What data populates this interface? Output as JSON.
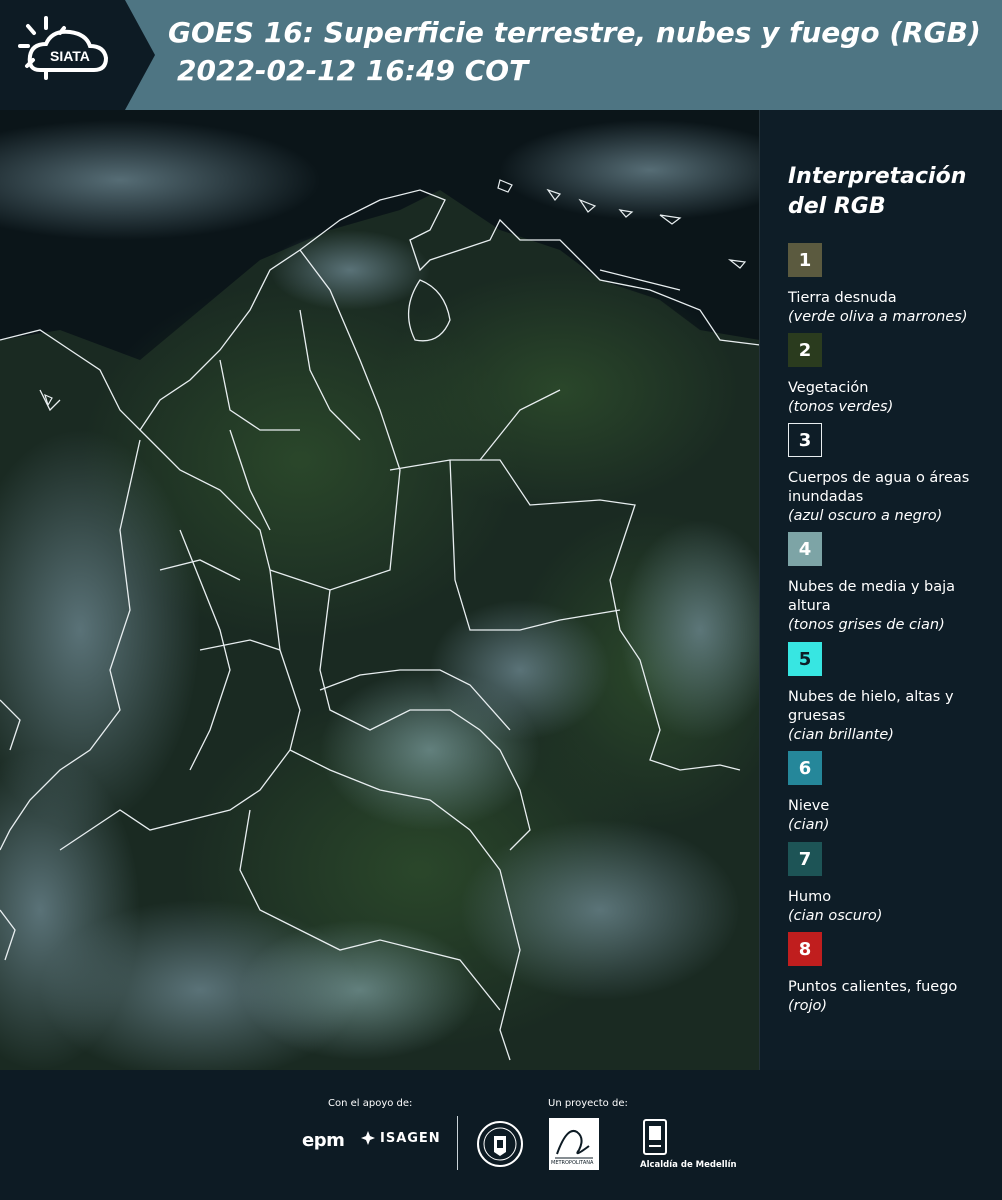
{
  "header": {
    "logo_text": "SIATA",
    "title_line1": "GOES 16: Superficie terrestre, nubes y fuego (RGB)",
    "title_line2": "2022-02-12 16:49 COT",
    "bar_color": "#4e7583",
    "logo_bg_color": "#0d1b24"
  },
  "map": {
    "description_icon": "satellite-map"
  },
  "legend": {
    "title_line1": "Interpretación",
    "title_line2": "del RGB",
    "items": [
      {
        "number": "1",
        "label": "Tierra desnuda",
        "desc": "(verde oliva a marrones)",
        "color": "#5b5a3f"
      },
      {
        "number": "2",
        "label": "Vegetación",
        "desc": "(tonos verdes)",
        "color": "#2a3b1e"
      },
      {
        "number": "3",
        "label": "Cuerpos de agua o áreas inundadas",
        "desc": "(azul oscuro a negro)",
        "color": "#0e1d27"
      },
      {
        "number": "4",
        "label": "Nubes de media y baja altura",
        "desc": "(tonos grises de cian)",
        "color": "#7da4a6"
      },
      {
        "number": "5",
        "label": "Nubes de hielo, altas y gruesas",
        "desc": "(cian brillante)",
        "color": "#37e6e2"
      },
      {
        "number": "6",
        "label": "Nieve",
        "desc": "(cian)",
        "color": "#25879a"
      },
      {
        "number": "7",
        "label": "Humo",
        "desc": "(cian oscuro)",
        "color": "#1d5456"
      },
      {
        "number": "8",
        "label": "Puntos calientes, fuego",
        "desc": "(rojo)",
        "color": "#c01e1e"
      }
    ]
  },
  "footer": {
    "support_label": "Con el apoyo de:",
    "project_label": "Un proyecto de:",
    "sponsor1": "epm",
    "sponsor2": "ISAGEN",
    "partner_area": "METROPOLITANA",
    "partner_medellin": "Alcaldía de Medellín"
  }
}
